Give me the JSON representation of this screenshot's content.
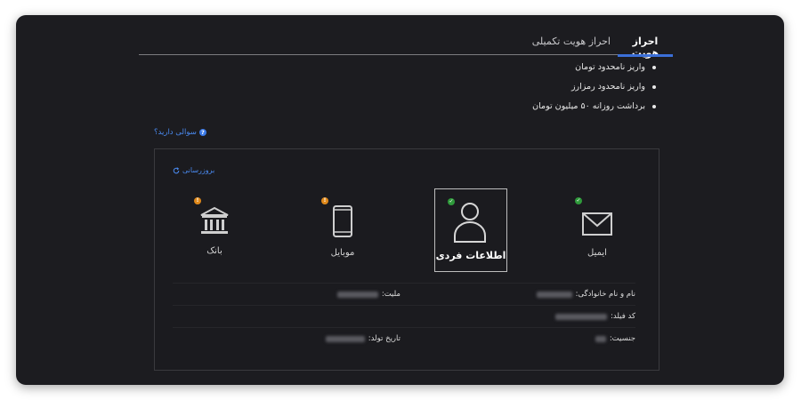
{
  "tabs": [
    {
      "label": "احراز هویت",
      "active": true
    },
    {
      "label": "احراز هویت تکمیلی",
      "active": false
    }
  ],
  "perks": [
    "واریز نامحدود تومان",
    "واریز نامحدود رمزارز",
    "برداشت روزانه ۵۰ میلیون تومان"
  ],
  "help_link": {
    "label": "سوالی دارید؟",
    "icon": "question-icon"
  },
  "refresh_link": {
    "label": "بروزرسانی",
    "icon": "refresh-icon"
  },
  "verification_cards": [
    {
      "label": "ایمیل",
      "icon": "envelope-icon",
      "status": "verified"
    },
    {
      "label": "اطلاعات فردی",
      "icon": "user-icon",
      "status": "verified",
      "selected": true
    },
    {
      "label": "موبایل",
      "icon": "mobile-icon",
      "status": "pending"
    },
    {
      "label": "بانک",
      "icon": "bank-icon",
      "status": "pending"
    }
  ],
  "info": {
    "full_name_label": "نام و نام خانوادگی:",
    "nationality_label": "ملیت:",
    "national_code_label": "کد فیلد:",
    "gender_label": "جنسیت:",
    "birth_date_label": "تاریخ تولد:"
  },
  "colors": {
    "background": "#1c1c20",
    "accent": "#3b6fd8",
    "verified": "#2f9a3b",
    "pending": "#e0891a"
  }
}
